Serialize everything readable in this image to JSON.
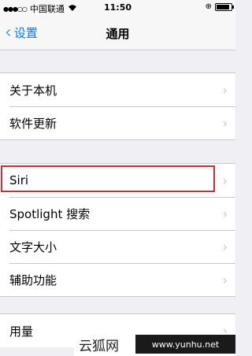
{
  "status_bar": {
    "carrier": "中国联通",
    "time": "11:50",
    "signal_icon": "signal-dots-icon",
    "wifi_icon": "wifi-icon",
    "rotation_lock_icon": "rotation-lock-icon",
    "battery_icon": "battery-icon"
  },
  "nav": {
    "back_label": "设置",
    "title": "通用"
  },
  "groups": [
    {
      "rows": [
        "关于本机",
        "软件更新"
      ]
    },
    {
      "rows": [
        "Siri",
        "Spotlight 搜索",
        "文字大小",
        "辅助功能"
      ]
    },
    {
      "rows": [
        "用量"
      ]
    }
  ],
  "highlight_row": "Siri",
  "highlight_color": "#c0303a",
  "accent_color": "#007aff",
  "watermark": {
    "cn": "云狐网",
    "url": "www.yunhu.net"
  }
}
